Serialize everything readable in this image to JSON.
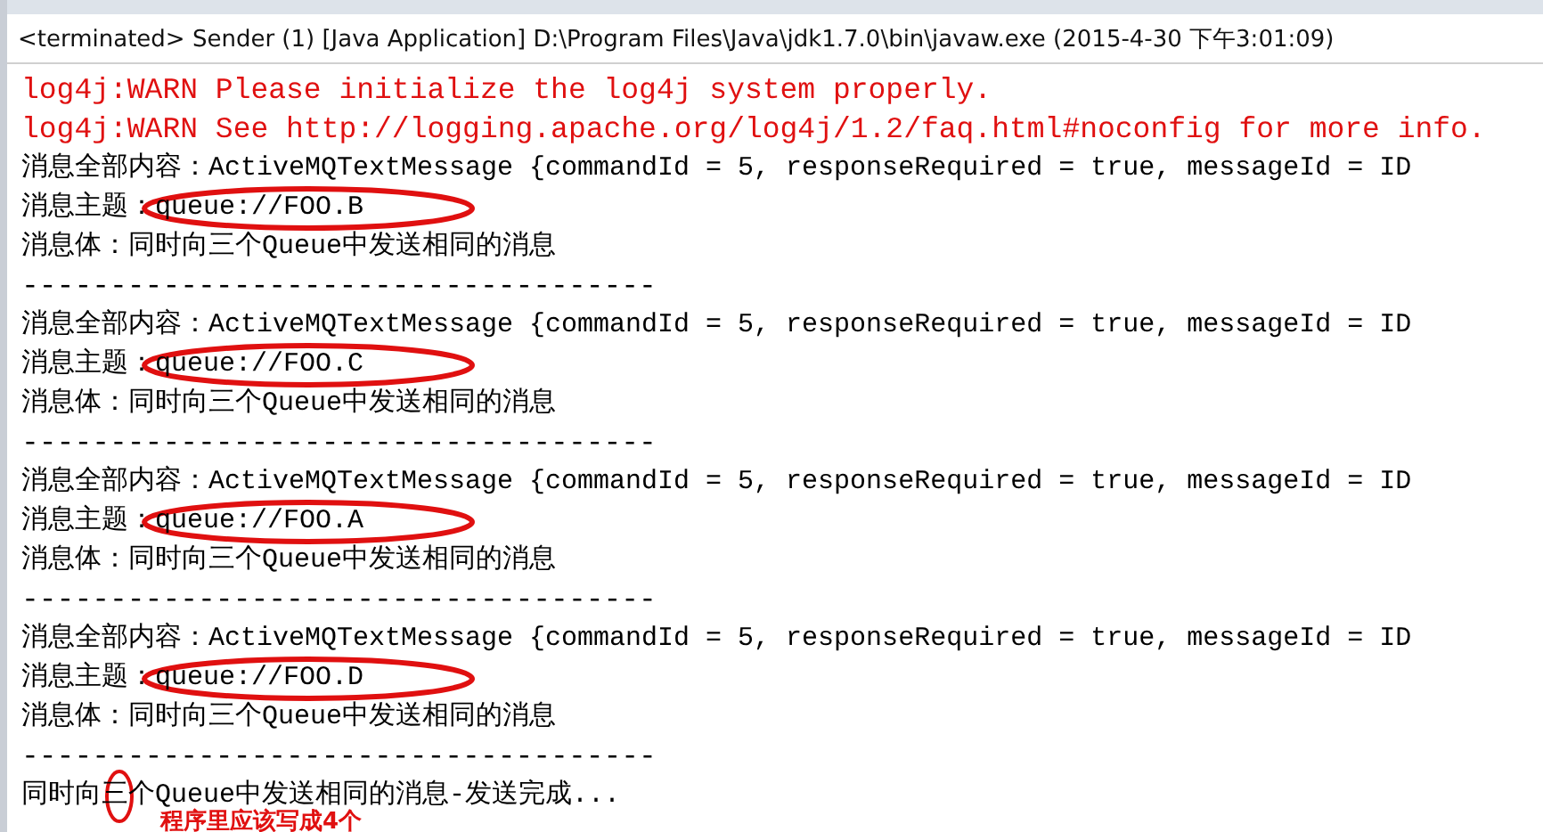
{
  "header": "<terminated> Sender (1) [Java Application] D:\\Program Files\\Java\\jdk1.7.0\\bin\\javaw.exe (2015-4-30 下午3:01:09)",
  "log_lines": [
    {
      "kind": "warn",
      "text": "log4j:WARN Please initialize the log4j system properly."
    },
    {
      "kind": "warn",
      "text": "log4j:WARN See http://logging.apache.org/log4j/1.2/faq.html#noconfig for more info."
    }
  ],
  "messages": [
    {
      "content": "消息全部内容：ActiveMQTextMessage {commandId = 5, responseRequired = true, messageId = ID",
      "topic": "消息主题：queue://FOO.B",
      "circled": true,
      "body": "消息体：同时向三个Queue中发送相同的消息",
      "separator": "------------------------------------"
    },
    {
      "content": "消息全部内容：ActiveMQTextMessage {commandId = 5, responseRequired = true, messageId = ID",
      "topic": "消息主题：queue://FOO.C",
      "circled": true,
      "body": "消息体：同时向三个Queue中发送相同的消息",
      "separator": "------------------------------------"
    },
    {
      "content": "消息全部内容：ActiveMQTextMessage {commandId = 5, responseRequired = true, messageId = ID",
      "topic": "消息主题：queue://FOO.A",
      "circled": true,
      "body": "消息体：同时向三个Queue中发送相同的消息",
      "separator": "------------------------------------"
    },
    {
      "content": "消息全部内容：ActiveMQTextMessage {commandId = 5, responseRequired = true, messageId = ID",
      "topic": "消息主题：queue://FOO.D",
      "circled": true,
      "body": "消息体：同时向三个Queue中发送相同的消息",
      "separator": "------------------------------------"
    }
  ],
  "final_line": {
    "text": "同时向三个Queue中发送相同的消息-发送完成...",
    "circled": true
  },
  "annotation": "程序里应该写成4个"
}
